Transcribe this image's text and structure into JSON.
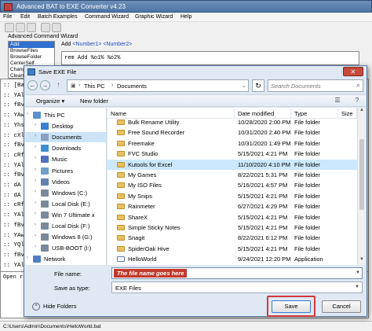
{
  "app": {
    "title": "Advanced BAT to EXE Converter v4.23",
    "menu": [
      "File",
      "Edit",
      "Batch Examples",
      "Command Wizard",
      "Graphic Wizard",
      "Help"
    ],
    "wizard_label": "Advanced Command Wizard",
    "wizard_items": [
      "Add",
      "BrowseFiles",
      "BrowseFolder",
      "CenterSelf",
      "Chang",
      "ClearC"
    ],
    "add_line": {
      "prefix": "Add",
      "args": "<Number1> <Number2>"
    },
    "command_text": "rem Add %o1% %o2%",
    "code_lines": [
      ":: [Ba",
      ":: YAl",
      ":: fBv",
      ":: YAw",
      ":: Yhs",
      ":: cXl",
      ":: fBv",
      ":: cRf",
      ":: YAl",
      ":: fBv",
      ":: dA",
      ":: dA",
      ":: cRf",
      ":: YAl",
      ":: fBv",
      ":: YAw",
      ":: YQl",
      ":: fBv",
      ":: YAl"
    ],
    "output_text": "Open r",
    "status_path": "C:\\Users\\Admin\\Documents\\HelloWorld.bat"
  },
  "dialog": {
    "title": "Save EXE File",
    "address": [
      "This PC",
      "Documents"
    ],
    "search_placeholder": "Search Documents",
    "organize_label": "Organize",
    "new_folder_label": "New folder",
    "nav_items": [
      {
        "label": "This PC",
        "icon": "computer-icon",
        "color": "#5a8fd0",
        "indent": 0,
        "selected": false
      },
      {
        "label": "Desktop",
        "icon": "desktop-icon",
        "color": "#3a80d0",
        "indent": 1,
        "selected": false
      },
      {
        "label": "Documents",
        "icon": "documents-icon",
        "color": "#8aa0c0",
        "indent": 1,
        "selected": true
      },
      {
        "label": "Downloads",
        "icon": "downloads-icon",
        "color": "#3a90d0",
        "indent": 1,
        "selected": false
      },
      {
        "label": "Music",
        "icon": "music-icon",
        "color": "#5070c0",
        "indent": 1,
        "selected": false
      },
      {
        "label": "Pictures",
        "icon": "pictures-icon",
        "color": "#70a0c8",
        "indent": 1,
        "selected": false
      },
      {
        "label": "Videos",
        "icon": "videos-icon",
        "color": "#6080b0",
        "indent": 1,
        "selected": false
      },
      {
        "label": "Windows (C:)",
        "icon": "drive-icon",
        "color": "#7a8a9a",
        "indent": 1,
        "selected": false
      },
      {
        "label": "Local Disk (E:)",
        "icon": "drive-icon",
        "color": "#7a8a9a",
        "indent": 1,
        "selected": false
      },
      {
        "label": "Win 7 Ultimate x",
        "icon": "drive-icon",
        "color": "#7a8a9a",
        "indent": 1,
        "selected": false
      },
      {
        "label": "Local Disk (F:)",
        "icon": "drive-icon",
        "color": "#7a8a9a",
        "indent": 1,
        "selected": false
      },
      {
        "label": "Windows 8 (G:)",
        "icon": "drive-icon",
        "color": "#7a8a9a",
        "indent": 1,
        "selected": false
      },
      {
        "label": "USB-BOOT (I:)",
        "icon": "usb-drive-icon",
        "color": "#7a8a9a",
        "indent": 1,
        "selected": false
      },
      {
        "label": "Network",
        "icon": "network-icon",
        "color": "#5080c0",
        "indent": 0,
        "selected": false
      }
    ],
    "columns": [
      "Name",
      "Date modified",
      "Type",
      "Size"
    ],
    "files": [
      {
        "name": "Bulk Rename Utility",
        "date": "10/28/2020 2:00 PM",
        "type": "File folder",
        "size": "",
        "icon": "folder",
        "selected": false
      },
      {
        "name": "Free Sound Recorder",
        "date": "10/31/2020 2:40 PM",
        "type": "File folder",
        "size": "",
        "icon": "folder",
        "selected": false
      },
      {
        "name": "Freemake",
        "date": "10/31/2020 1:49 PM",
        "type": "File folder",
        "size": "",
        "icon": "folder",
        "selected": false
      },
      {
        "name": "FVC Studio",
        "date": "5/15/2021 4:21 PM",
        "type": "File folder",
        "size": "",
        "icon": "folder",
        "selected": false
      },
      {
        "name": "Kutools for Excel",
        "date": "11/10/2020 4:10 PM",
        "type": "File folder",
        "size": "",
        "icon": "folder",
        "selected": true
      },
      {
        "name": "My Games",
        "date": "8/22/2021 5:31 PM",
        "type": "File folder",
        "size": "",
        "icon": "folder",
        "selected": false
      },
      {
        "name": "My ISO Files",
        "date": "5/16/2021 4:57 PM",
        "type": "File folder",
        "size": "",
        "icon": "folder",
        "selected": false
      },
      {
        "name": "My Snips",
        "date": "5/15/2021 4:21 PM",
        "type": "File folder",
        "size": "",
        "icon": "folder",
        "selected": false
      },
      {
        "name": "Rainmeter",
        "date": "6/27/2021 4:29 PM",
        "type": "File folder",
        "size": "",
        "icon": "folder",
        "selected": false
      },
      {
        "name": "ShareX",
        "date": "5/15/2021 4:21 PM",
        "type": "File folder",
        "size": "",
        "icon": "folder",
        "selected": false
      },
      {
        "name": "Simple Sticky Notes",
        "date": "5/15/2021 4:21 PM",
        "type": "File folder",
        "size": "",
        "icon": "folder",
        "selected": false
      },
      {
        "name": "Snagit",
        "date": "8/22/2021 6:12 PM",
        "type": "File folder",
        "size": "",
        "icon": "folder",
        "selected": false
      },
      {
        "name": "SpiderOak Hive",
        "date": "5/15/2021 4:21 PM",
        "type": "File folder",
        "size": "",
        "icon": "folder",
        "selected": false
      },
      {
        "name": "HelloWorld",
        "date": "9/24/2021 12:20 PM",
        "type": "Application",
        "size": "",
        "icon": "app",
        "selected": false
      }
    ],
    "file_name_label": "File name:",
    "file_name_value": "The file name goes here",
    "save_type_label": "Save as type:",
    "save_type_value": "EXE Files",
    "hide_folders_label": "Hide Folders",
    "save_label": "Save",
    "cancel_label": "Cancel",
    "highlight_color": "#d03a3a"
  }
}
